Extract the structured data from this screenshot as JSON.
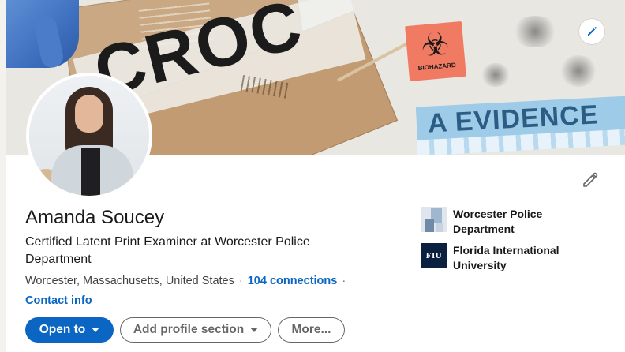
{
  "profile": {
    "name": "Amanda Soucey",
    "headline": "Certified Latent Print Examiner at Worcester Police Department",
    "location": "Worcester, Massachusetts, United States",
    "connections": "104 connections",
    "contact_info": "Contact info",
    "separator": "·"
  },
  "banner": {
    "crow_text": "CROC",
    "biohazard_label": "BIOHAZARD",
    "evidence_text": "A EVIDENCE"
  },
  "actions": {
    "open_to": "Open to",
    "add_profile_section": "Add profile section",
    "more": "More..."
  },
  "experience": [
    {
      "name": "Worcester Police Department",
      "icon": "worcester-police-logo"
    },
    {
      "name": "Florida International University",
      "icon": "fiu-logo",
      "logo_text": "FIU"
    }
  ],
  "icons": {
    "edit_cover": "pencil-icon",
    "edit_intro": "pencil-icon"
  },
  "colors": {
    "brand_blue": "#0a66c2",
    "fiu_navy": "#0b1f3f"
  }
}
